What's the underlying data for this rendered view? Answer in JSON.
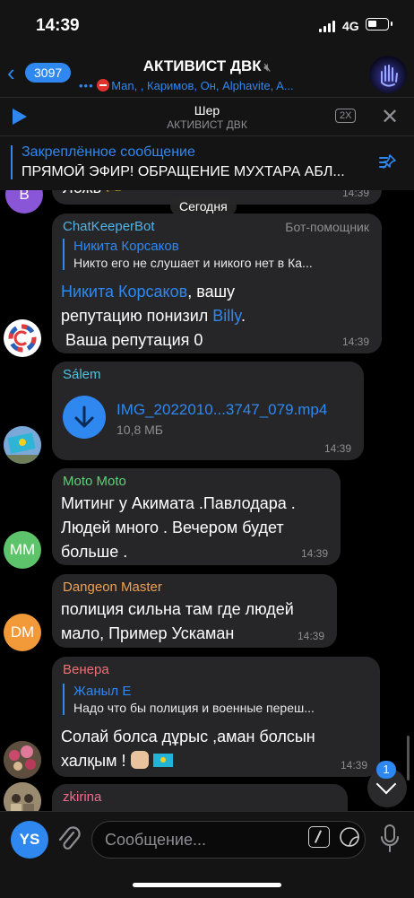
{
  "status_bar": {
    "time": "14:39",
    "network": "4G"
  },
  "header": {
    "back_count": "3097",
    "title": "АКТИВИСТ ДВК",
    "members_preview": "Man, , Каримов, Он, Alphavite, A..."
  },
  "player": {
    "track_name": "Шер",
    "chat_name": "АКТИВИСТ ДВК",
    "speed": "2X"
  },
  "pinned": {
    "title": "Закреплённое сообщение",
    "text": "ПРЯМОЙ ЭФИР! ОБРАЩЕНИЕ МУХТАРА АБЛ..."
  },
  "messages": {
    "partial": {
      "text": "Ложь",
      "time": "14:39",
      "avatar_letter": "B"
    },
    "date_divider": "Сегодня",
    "bot": {
      "sender": "ChatKeeperBot",
      "role": "Бот-помощник",
      "reply_name": "Никита Корсаков",
      "reply_text": "Никто его не слушает и никого нет в Ка...",
      "mention_user": "Никита Корсаков",
      "text_part1": ", вашу",
      "text_part2": "репутацию понизил ",
      "mention_by": "Billy",
      "text_part3": ".",
      "text_part4": " Ваша репутация 0",
      "time": "14:39"
    },
    "file": {
      "sender": "Sálem",
      "file_name": "IMG_2022010...3747_079.mp4",
      "file_size": "10,8 МБ",
      "time": "14:39"
    },
    "moto": {
      "sender": "Moto Moto",
      "line1": "Митинг у Акимата .Павлодара .",
      "line2": "Людей много . Вечером будет",
      "line3": "больше .",
      "time": "14:39",
      "avatar": "MM"
    },
    "dungeon": {
      "sender": "Dangeon Master",
      "line1": "полиция сильна там где людей",
      "line2": "мало, Пример Ускаман",
      "time": "14:39",
      "avatar": "DM"
    },
    "venera": {
      "sender": "Венера",
      "reply_name": "Жаныл Е",
      "reply_text": "Надо что бы полиция и военные переш...",
      "line1": "Солай болса дұрыс ,аман болсын",
      "line2": "халқым !",
      "time": "14:39"
    },
    "zkirina": {
      "sender": "zkirina"
    }
  },
  "composer": {
    "user_initials": "YS",
    "placeholder": "Сообщение..."
  },
  "scroll": {
    "unread": "1"
  },
  "colors": {
    "accent": "#2f88f0",
    "bubble": "#262628",
    "bot_sender": "#4fb3e8",
    "salem_sender": "#4fc3e0",
    "moto_sender": "#5fd07a",
    "dungeon_sender": "#f0a050",
    "venera_sender": "#f07070",
    "zkirina_sender": "#f06b8a"
  }
}
